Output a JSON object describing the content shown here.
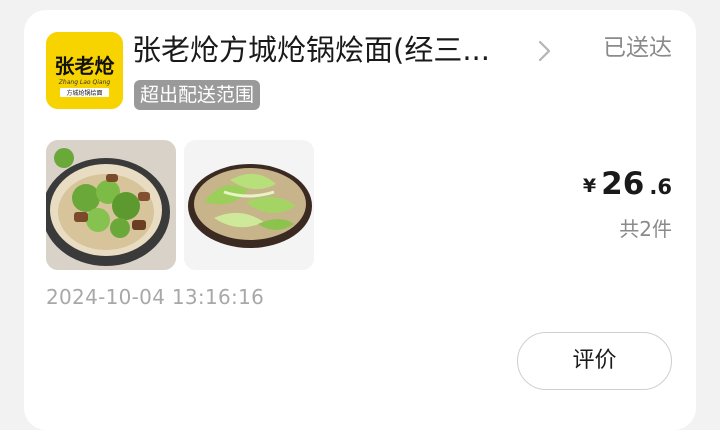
{
  "order": {
    "store_name": "张老炝方城炝锅烩面(经三...",
    "status": "已送达",
    "tag": "超出配送范围",
    "price_currency": "¥",
    "price_integer": "26",
    "price_decimal": ".6",
    "item_count": "共2件",
    "time": "2024-10-04 13:16:16",
    "review_label": "评价"
  },
  "logo": {
    "brand_text": "张老炝",
    "pinyin": "Zhang Lao Qiang",
    "subtitle": "方城炝锅烩面",
    "bg_color": "#f7d400"
  },
  "icons": {
    "chevron": "chevron-right-icon"
  }
}
